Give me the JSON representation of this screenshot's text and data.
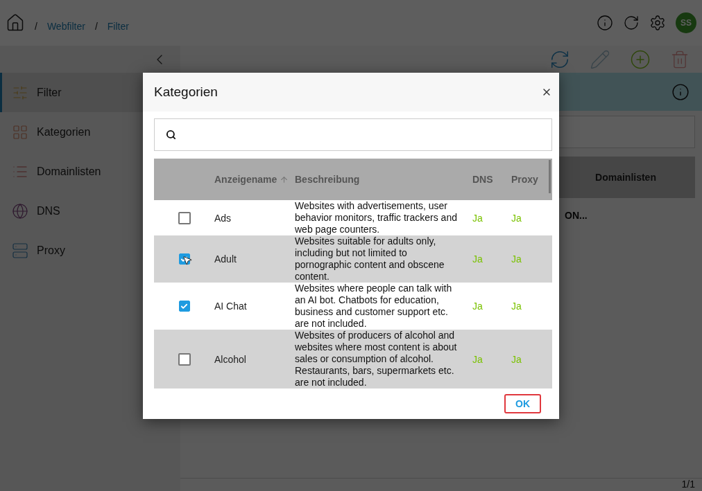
{
  "header": {
    "breadcrumbs": [
      {
        "separator": "/",
        "label": "Webfilter"
      },
      {
        "separator": "/",
        "label": "Filter"
      }
    ],
    "avatar": "SS"
  },
  "sidebar": {
    "items": [
      {
        "label": "Filter",
        "kind": "filter",
        "selected": true
      },
      {
        "label": "Kategorien",
        "kind": "categories",
        "selected": false
      },
      {
        "label": "Domainlisten",
        "kind": "lists",
        "selected": false
      },
      {
        "label": "DNS",
        "kind": "dns",
        "selected": false
      },
      {
        "label": "Proxy",
        "kind": "proxy",
        "selected": false
      }
    ]
  },
  "main": {
    "table": {
      "column": "Domainlisten",
      "row_text": "ON..."
    },
    "pager": "1/1"
  },
  "dialog": {
    "title": "Kategorien",
    "columns": [
      {
        "label": "Anzeigename",
        "sorted": true
      },
      {
        "label": "Beschreibung",
        "sorted": false
      },
      {
        "label": "DNS",
        "sorted": false
      },
      {
        "label": "Proxy",
        "sorted": false
      }
    ],
    "rows": [
      {
        "checked": false,
        "name": "Ads",
        "description": "Websites with advertisements, user behavior monitors, traffic trackers and web page counters.",
        "dns": "Ja",
        "proxy": "Ja"
      },
      {
        "checked": true,
        "name": "Adult",
        "description": "Websites suitable for adults only, including but not limited to pornographic content and obscene content.",
        "dns": "Ja",
        "proxy": "Ja"
      },
      {
        "checked": true,
        "name": "AI Chat",
        "description": "Websites where people can talk with an AI bot. Chatbots for education, business and customer support etc. are not included.",
        "dns": "Ja",
        "proxy": "Ja"
      },
      {
        "checked": false,
        "name": "Alcohol",
        "description": "Websites of producers of alcohol and websites where most content is about sales or consumption of alcohol. Restaurants, bars, supermarkets etc. are not included.",
        "dns": "Ja",
        "proxy": "Ja"
      }
    ],
    "ok_button": "OK"
  }
}
